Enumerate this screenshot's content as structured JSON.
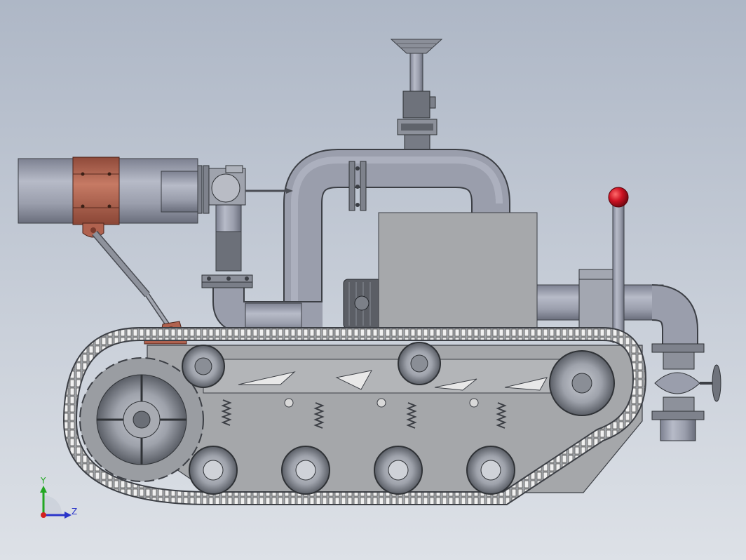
{
  "viewport": {
    "background_top": "#aeb7c6",
    "background_bottom": "#dde1e7"
  },
  "triad": {
    "y_label": "Y",
    "z_label": "Z",
    "y_color": "#22a722",
    "z_color": "#2a35c9",
    "x_color": "#d32020"
  },
  "colors": {
    "body_gray": "#a6a8ab",
    "pipe_gray": "#9a9eac",
    "dark_gray": "#5c5f66",
    "copper": "#b0624f",
    "knob_red": "#cc1122",
    "track": "#8e9196"
  }
}
